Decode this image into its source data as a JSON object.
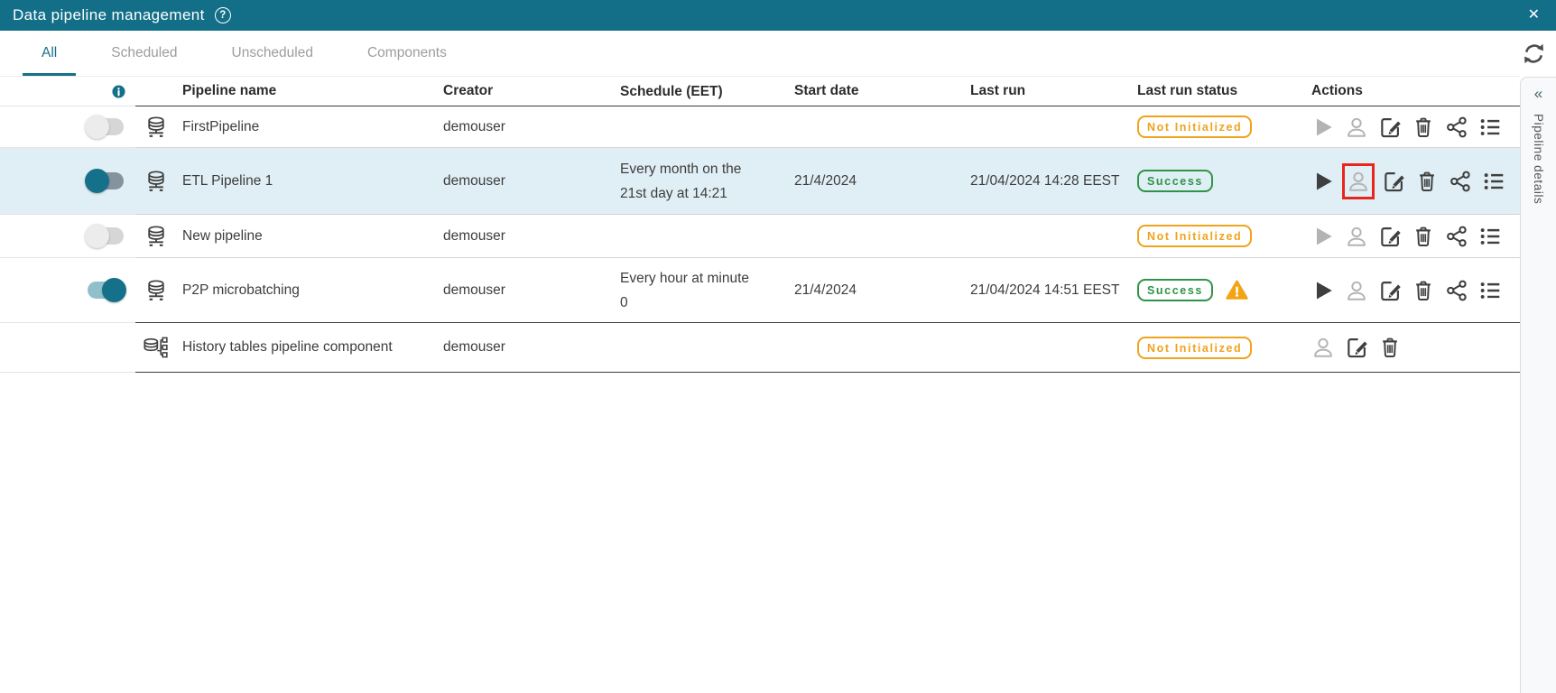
{
  "titlebar": {
    "title": "Data pipeline management"
  },
  "icons": {
    "help": "?",
    "close": "✕",
    "collapse": "«"
  },
  "tabs": [
    {
      "label": "All",
      "active": true
    },
    {
      "label": "Scheduled",
      "active": false
    },
    {
      "label": "Unscheduled",
      "active": false
    },
    {
      "label": "Components",
      "active": false
    }
  ],
  "table": {
    "headers": {
      "pipeline_name": "Pipeline name",
      "creator": "Creator",
      "schedule": "Schedule (EET)",
      "start_date": "Start date",
      "last_run": "Last run",
      "last_run_status": "Last run status",
      "actions": "Actions"
    },
    "rows": [
      {
        "name": "FirstPipeline",
        "type": "pipeline",
        "toggle": "off",
        "creator": "demouser",
        "schedule_line1": "",
        "schedule_line2": "",
        "start_date": "",
        "last_run": "",
        "status": "Not Initialized",
        "status_color": "#f0a31c",
        "warning": false,
        "highlighted": false
      },
      {
        "name": "ETL Pipeline 1",
        "type": "pipeline",
        "toggle": "on-knob-left",
        "creator": "demouser",
        "schedule_line1": "Every month on the",
        "schedule_line2": "21st day at 14:21",
        "start_date": "21/4/2024",
        "last_run": "21/04/2024 14:28 EEST",
        "status": "Success",
        "status_color": "#2e9447",
        "warning": false,
        "highlighted": true,
        "person_action_highlighted_red": true
      },
      {
        "name": "New pipeline",
        "type": "pipeline",
        "toggle": "off",
        "creator": "demouser",
        "schedule_line1": "",
        "schedule_line2": "",
        "start_date": "",
        "last_run": "",
        "status": "Not Initialized",
        "status_color": "#f0a31c",
        "warning": false,
        "highlighted": false
      },
      {
        "name": "P2P microbatching",
        "type": "pipeline",
        "toggle": "on",
        "creator": "demouser",
        "schedule_line1": "Every hour at minute",
        "schedule_line2": "0",
        "start_date": "21/4/2024",
        "last_run": "21/04/2024 14:51 EEST",
        "status": "Success",
        "status_color": "#2e9447",
        "warning": true,
        "highlighted": false
      },
      {
        "name": "History tables pipeline component",
        "type": "component",
        "toggle": "none",
        "creator": "demouser",
        "schedule_line1": "",
        "schedule_line2": "",
        "start_date": "",
        "last_run": "",
        "status": "Not Initialized",
        "status_color": "#f0a31c",
        "warning": false,
        "highlighted": false
      }
    ]
  },
  "right_panel": {
    "label": "Pipeline details"
  },
  "colors": {
    "titlebar": "#136f88",
    "accent_teal": "#15708a",
    "row_highlight": "#e0eff5",
    "badge_orange": "#f0a31c",
    "badge_green": "#2e9447",
    "warning_orange": "#f2a414",
    "red_highlight_box": "#e8261c",
    "icon": "#3f3f3f",
    "disabled_icon": "#b3b3b3"
  }
}
